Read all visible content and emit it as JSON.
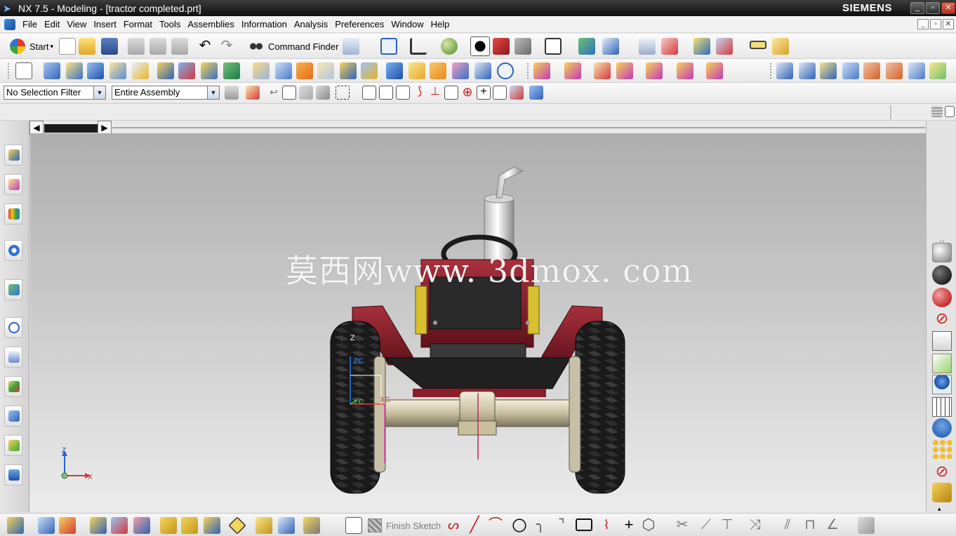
{
  "window": {
    "title": "NX 7.5 - Modeling - [tractor completed.prt]",
    "brand": "SIEMENS",
    "controls": {
      "minimize": "_",
      "maximize": "▫",
      "close": "✕"
    }
  },
  "menubar": {
    "items": [
      "File",
      "Edit",
      "View",
      "Insert",
      "Format",
      "Tools",
      "Assemblies",
      "Information",
      "Analysis",
      "Preferences",
      "Window",
      "Help"
    ]
  },
  "toolbar_standard": {
    "start_label": "Start",
    "command_finder_label": "Command Finder"
  },
  "selection_bar": {
    "filter_value": "No Selection Filter",
    "scope_value": "Entire Assembly"
  },
  "viewport": {
    "watermark": "莫西网www. 3dmox. com",
    "csys_labels": {
      "z": "Z",
      "zc": "ZC",
      "yc": "YC",
      "xc": "XC"
    },
    "triad_labels": {
      "z": "Z",
      "x": "X"
    }
  },
  "bottom_toolbar": {
    "finish_sketch_label": "Finish Sketch"
  },
  "colors": {
    "tractor_body": "#8c1d2a",
    "tire": "#1e1e1e",
    "axle": "#d8d0b8",
    "accent_yellow": "#d8c030"
  }
}
